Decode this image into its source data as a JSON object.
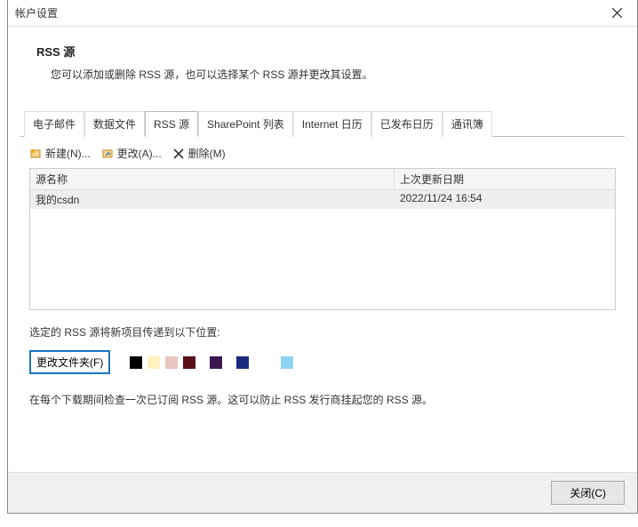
{
  "window": {
    "title": "帐户设置"
  },
  "header": {
    "title": "RSS 源",
    "description": "您可以添加或删除 RSS 源，也可以选择某个 RSS 源并更改其设置。"
  },
  "tabs": {
    "items": [
      {
        "label": "电子邮件"
      },
      {
        "label": "数据文件"
      },
      {
        "label": "RSS 源",
        "active": true
      },
      {
        "label": "SharePoint 列表"
      },
      {
        "label": "Internet 日历"
      },
      {
        "label": "已发布日历"
      },
      {
        "label": "通讯簿"
      }
    ]
  },
  "toolbar": {
    "new_label": "新建(N)...",
    "change_label": "更改(A)...",
    "delete_label": "删除(M)"
  },
  "table": {
    "col_name": "源名称",
    "col_date": "上次更新日期",
    "rows": [
      {
        "name": "我的csdn",
        "date": "2022/11/24 16:54"
      }
    ]
  },
  "deliver": {
    "label": "选定的 RSS 源将新项目传递到以下位置:",
    "button": "更改文件夹(F)",
    "blocks": [
      "#000000",
      "#fdf2c0",
      "#e8c6c0",
      "#5a1018",
      "#3a1850",
      "#1a2a80"
    ],
    "blocks2": [
      "#8ed4f0"
    ]
  },
  "note": {
    "prefix": "在每个下载期间检查一次已订阅 RSS 源。这可以防止 RSS 发行商挂起您的 RSS 源。",
    "inline_blocks": [
      "#d4933a",
      "#f0dca0"
    ]
  },
  "footer": {
    "close": "关闭(C)"
  }
}
